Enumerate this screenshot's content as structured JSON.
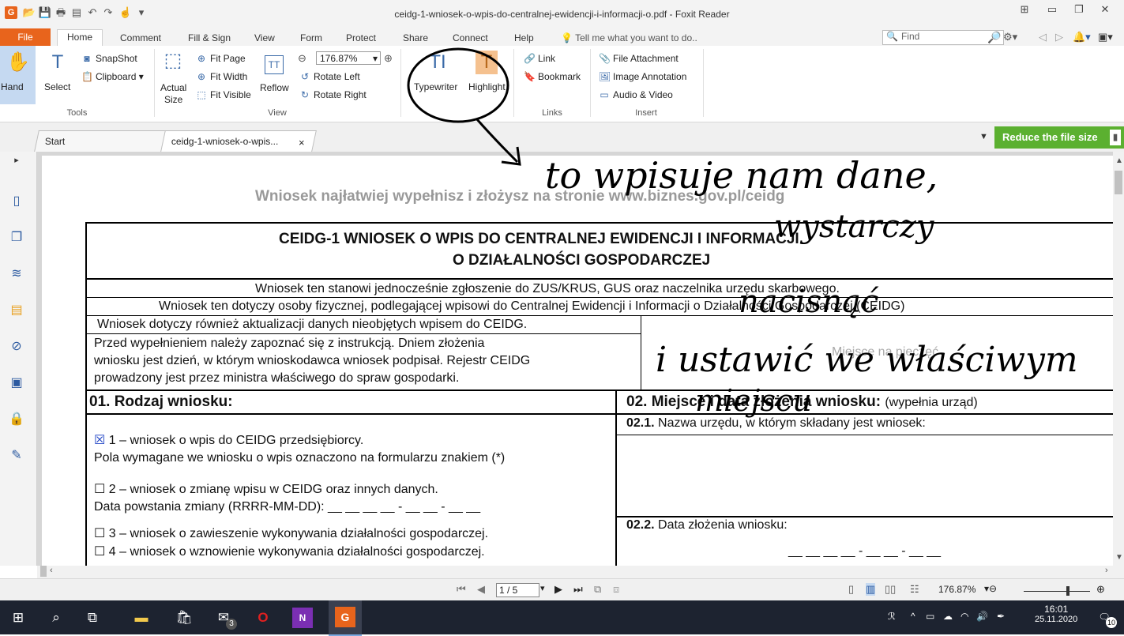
{
  "window": {
    "title": "ceidg-1-wniosek-o-wpis-do-centralnej-ewidencji-i-informacji-o.pdf - Foxit Reader",
    "app_icon": "G"
  },
  "menu_tabs": [
    "File",
    "Home",
    "Comment",
    "Fill & Sign",
    "View",
    "Form",
    "Protect",
    "Share",
    "Connect",
    "Help"
  ],
  "tell_me": "Tell me what you want to do..",
  "find_placeholder": "Find",
  "ribbon": {
    "hand": "Hand",
    "select": "Select",
    "snapshot": "SnapShot",
    "clipboard": "Clipboard",
    "tools_label": "Tools",
    "actual": "Actual",
    "size": "Size",
    "fit_page": "Fit Page",
    "fit_width": "Fit Width",
    "fit_visible": "Fit Visible",
    "reflow": "Reflow",
    "zoom": "176.87%",
    "rotate_left": "Rotate Left",
    "rotate_right": "Rotate Right",
    "view_label": "View",
    "typewriter": "Typewriter",
    "highlight": "Highlight",
    "link": "Link",
    "bookmark": "Bookmark",
    "links_label": "Links",
    "file_attachment": "File Attachment",
    "image_annotation": "Image Annotation",
    "audio_video": "Audio & Video",
    "insert_label": "Insert"
  },
  "doc_tabs": {
    "start": "Start",
    "current": "ceidg-1-wniosek-o-wpis...",
    "close": "×",
    "reduce": "Reduce the file size"
  },
  "document": {
    "banner": "Wniosek najłatwiej wypełnisz i złożysz na stronie www.biznes.gov.pl/ceidg",
    "heading1": "CEIDG-1 WNIOSEK O WPIS DO CENTRALNEJ EWIDENCJI I INFORMACJI",
    "heading2": "O DZIAŁALNOŚCI GOSPODARCZEJ",
    "row1": "Wniosek ten stanowi jednocześnie zgłoszenie do ZUS/KRUS, GUS oraz naczelnika urzędu skarbowego.",
    "row2": "Wniosek ten dotyczy osoby fizycznej, podlegającej wpisowi do Centralnej Ewidencji i Informacji o Działalności Gospodarczej (CEIDG)",
    "row3": "Wniosek dotyczy również aktualizacji danych nieobjętych wpisem do CEIDG.",
    "intro1": "Przed wypełnieniem należy zapoznać się z instrukcją. Dniem złożenia",
    "intro2": "wniosku jest dzień, w którym wnioskodawca wniosek podpisał. Rejestr CEIDG",
    "intro3": "prowadzony jest przez ministra właściwego do spraw gospodarki.",
    "stamp": "Miejsce na pieczęć",
    "sec01": "01. Rodzaj wniosku:",
    "sec02": "02. Miejsce i data złożenia wniosku:",
    "sec02_note": "(wypełnia urząd)",
    "opt1_box": "☒",
    "opt1": "1 – wniosek o wpis do CEIDG przedsiębiorcy.",
    "opt1_note": "Pola wymagane we wniosku o wpis oznaczono na formularzu znakiem (*)",
    "opt2": "☐ 2 – wniosek o zmianę wpisu w CEIDG oraz innych danych.",
    "opt2_date": "Data powstania zmiany (RRRR-MM-DD): __ __ __ __ - __ __ - __ __",
    "opt3": "☐ 3 – wniosek o zawieszenie wykonywania działalności gospodarczej.",
    "opt4": "☐ 4 – wniosek o wznowienie wykonywania działalności gospodarczej.",
    "f021_num": "02.1.",
    "f021": "Nazwa urzędu, w którym składany jest wniosek:",
    "f022_num": "02.2.",
    "f022": "Data złożenia wniosku:",
    "f022_date": "__ __ __ __ - __ __ - __ __"
  },
  "navbar": {
    "page": "1 / 5",
    "zoom": "176.87%"
  },
  "taskbar": {
    "time": "16:01",
    "date": "25.11.2020",
    "notif": "10",
    "mail_badge": "3"
  },
  "handwriting": {
    "line1": "to wpisuje nam dane,",
    "line2": "wystarczy",
    "line3": "nacisnąć",
    "line4": "i ustawić we właściwym",
    "line5": "miejscu"
  }
}
